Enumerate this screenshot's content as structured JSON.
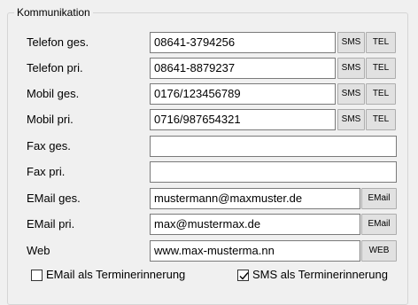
{
  "group": {
    "title": "Kommunikation"
  },
  "rows": [
    {
      "label": "Telefon ges.",
      "value": "08641-3794256",
      "btn1": "SMS",
      "btn2": "TEL"
    },
    {
      "label": "Telefon pri.",
      "value": "08641-8879237",
      "btn1": "SMS",
      "btn2": "TEL"
    },
    {
      "label": "Mobil ges.",
      "value": "0176/123456789",
      "btn1": "SMS",
      "btn2": "TEL"
    },
    {
      "label": "Mobil pri.",
      "value": "0716/987654321",
      "btn1": "SMS",
      "btn2": "TEL"
    },
    {
      "label": "Fax ges.",
      "value": ""
    },
    {
      "label": "Fax pri.",
      "value": ""
    },
    {
      "label": "EMail ges.",
      "value": "mustermann@maxmuster.de",
      "btn": "EMail"
    },
    {
      "label": "EMail pri.",
      "value": "max@mustermax.de",
      "btn": "EMail"
    },
    {
      "label": "Web",
      "value": "www.max-musterma.nn",
      "btn": "WEB"
    }
  ],
  "checkboxes": [
    {
      "label": "EMail als Terminerinnerung",
      "checked": false
    },
    {
      "label": "SMS als Terminerinnerung",
      "checked": true
    }
  ]
}
